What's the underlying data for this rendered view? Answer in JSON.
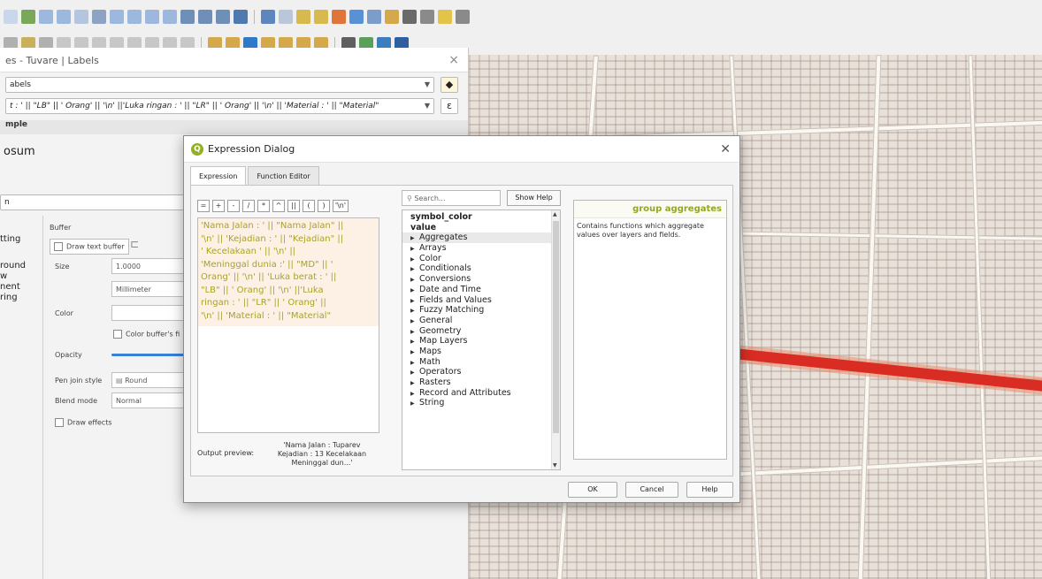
{
  "layer_panel": {
    "window_title": "es - Tuvare | Labels",
    "mode_select": "abels",
    "expression_field": "t : ' || \"LB\" || ' Orang' || '\\n' ||'Luka ringan : ' || \"LR\" || ' Orang' || '\\n' || 'Material : ' || \"Material\"",
    "expression_button": "ε",
    "section_sample": "mple",
    "sample_text": "osum",
    "filter_text": "n",
    "side_items": [
      "tting",
      "round",
      "w",
      "nent",
      "ring"
    ],
    "buffer_heading": "Buffer",
    "draw_text_buffer": "Draw text buffer",
    "size_label": "Size",
    "size_value": "1.0000",
    "unit_value": "Millimeter",
    "color_label": "Color",
    "color_buffer_fill": "Color buffer's fi",
    "opacity_label": "Opacity",
    "pen_join_label": "Pen join style",
    "pen_join_value": "Round",
    "blend_label": "Blend mode",
    "blend_value": "Normal",
    "draw_effects": "Draw effects"
  },
  "dialog": {
    "title": "Expression Dialog",
    "tabs": [
      "Expression",
      "Function Editor"
    ],
    "operators": [
      "=",
      "+",
      "-",
      "/",
      "*",
      "^",
      "||",
      "(",
      ")",
      "'\\n'"
    ],
    "expression_lines": [
      "'Nama Jalan : ' ||  \"Nama Jalan\"  ||",
      "'\\n' || 'Kejadian : ' ||  \"Kejadian\"  ||",
      "' Kecelakaan ' ||  '\\n'  ||",
      "'Meninggal dunia :' ||  \"MD\"  || '",
      "Orang' ||  '\\n'  || 'Luka berat : ' ||",
      "\"LB\"  || ' Orang' ||  '\\n'  ||'Luka",
      "ringan : ' ||  \"LR\"  || ' Orang'  ||",
      "'\\n'  || 'Material : ' ||  \"Material\""
    ],
    "output_preview_label": "Output preview:",
    "output_preview_lines": [
      "'Nama Jalan : Tuparev",
      "Kejadian : 13 Kecelakaan",
      "Meninggal dun...'"
    ],
    "search_placeholder": "Search...",
    "show_help": "Show Help",
    "function_items": [
      {
        "label": "symbol_color",
        "kind": "var"
      },
      {
        "label": "value",
        "kind": "var"
      },
      {
        "label": "Aggregates",
        "kind": "group",
        "selected": true
      },
      {
        "label": "Arrays",
        "kind": "group"
      },
      {
        "label": "Color",
        "kind": "group"
      },
      {
        "label": "Conditionals",
        "kind": "group"
      },
      {
        "label": "Conversions",
        "kind": "group"
      },
      {
        "label": "Date and Time",
        "kind": "group"
      },
      {
        "label": "Fields and Values",
        "kind": "group"
      },
      {
        "label": "Fuzzy Matching",
        "kind": "group"
      },
      {
        "label": "General",
        "kind": "group"
      },
      {
        "label": "Geometry",
        "kind": "group"
      },
      {
        "label": "Map Layers",
        "kind": "group"
      },
      {
        "label": "Maps",
        "kind": "group"
      },
      {
        "label": "Math",
        "kind": "group"
      },
      {
        "label": "Operators",
        "kind": "group"
      },
      {
        "label": "Rasters",
        "kind": "group"
      },
      {
        "label": "Record and Attributes",
        "kind": "group"
      },
      {
        "label": "String",
        "kind": "group"
      }
    ],
    "help_title": "group aggregates",
    "help_text": "Contains functions which aggregate values over layers and fields.",
    "ok": "OK",
    "cancel": "Cancel",
    "help": "Help"
  },
  "colors": {
    "accent_green": "#93b023",
    "expression_string": "#a8a228",
    "expression_field": "#cf8a1f",
    "highway_red": "#d92d23"
  }
}
